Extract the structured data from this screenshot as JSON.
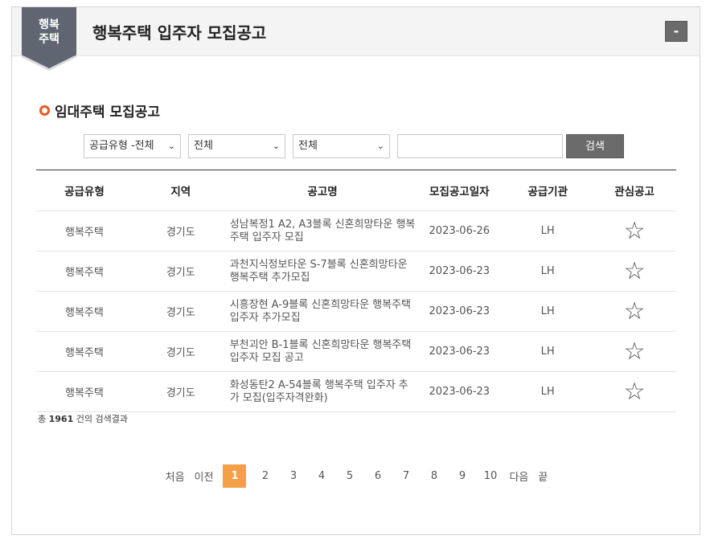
{
  "header": {
    "badge_line1": "행복",
    "badge_line2": "주택",
    "title": "행복주택 입주자 모집공고",
    "collapse_label": "-"
  },
  "section": {
    "title": "임대주택 모집공고"
  },
  "filters": {
    "supply_type": "공급유형 -전체",
    "region": "전체",
    "sub_region": "전체",
    "search_placeholder": "",
    "search_label": "검색"
  },
  "table": {
    "headers": [
      "공급유형",
      "지역",
      "공고명",
      "모집공고일자",
      "공급기관",
      "관심공고"
    ],
    "rows": [
      {
        "type": "행복주택",
        "region": "경기도",
        "title": "성남복정1 A2, A3블록 신혼희망타운 행복주택 입주자 모집",
        "date": "2023-06-26",
        "agency": "LH"
      },
      {
        "type": "행복주택",
        "region": "경기도",
        "title": "과천지식정보타운 S-7블록 신혼희망타운 행복주택 추가모집",
        "date": "2023-06-23",
        "agency": "LH"
      },
      {
        "type": "행복주택",
        "region": "경기도",
        "title": "시흥장현 A-9블록 신혼희망타운 행복주택 입주자 추가모집",
        "date": "2023-06-23",
        "agency": "LH"
      },
      {
        "type": "행복주택",
        "region": "경기도",
        "title": "부천괴안 B-1블록 신혼희망타운 행복주택 입주자 모집 공고",
        "date": "2023-06-23",
        "agency": "LH"
      },
      {
        "type": "행복주택",
        "region": "경기도",
        "title": "화성동탄2 A-54블록 행복주택 입주자 추가 모집(입주자격완화)",
        "date": "2023-06-23",
        "agency": "LH"
      }
    ]
  },
  "result": {
    "prefix": "총",
    "count": "1961",
    "suffix": "건의 검색결과"
  },
  "pager": {
    "first": "처음",
    "prev": "이전",
    "pages": [
      "1",
      "2",
      "3",
      "4",
      "5",
      "6",
      "7",
      "8",
      "9",
      "10"
    ],
    "current": "1",
    "next": "다음",
    "last": "끝"
  },
  "colors": {
    "accent": "#f5a047",
    "ribbon": "#5f6672",
    "button": "#6b6b6b",
    "bullet": "#e8592a"
  }
}
